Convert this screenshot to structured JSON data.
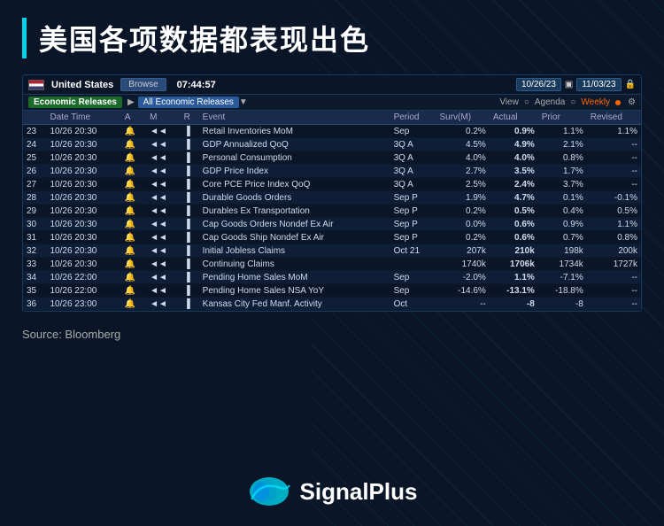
{
  "page": {
    "background": "#0a1628",
    "title": "美国各项数据都表现出色",
    "source": "Source: Bloomberg"
  },
  "terminal": {
    "country": "United States",
    "browse_label": "Browse",
    "time": "07:44:57",
    "date_from": "10/26/23",
    "date_to": "11/03/23",
    "tab_economic": "Economic Releases",
    "tab_all": "All Economic Releases",
    "view_label": "View",
    "agenda_label": "Agenda",
    "weekly_label": "Weekly",
    "columns": {
      "date_time": "Date Time",
      "a": "A",
      "m": "M",
      "r": "R",
      "event": "Event",
      "period": "Period",
      "surv": "Surv(M)",
      "actual": "Actual",
      "prior": "Prior",
      "revised": "Revised"
    },
    "rows": [
      {
        "num": "23",
        "date": "10/26",
        "time": "20:30",
        "a": "🔔",
        "m": "↓",
        "r": "▐",
        "event": "Retail Inventories MoM",
        "period": "Sep",
        "surv": "0.2%",
        "actual": "0.9%",
        "prior": "1.1%",
        "revised": "1.1%",
        "actual_neg": false
      },
      {
        "num": "24",
        "date": "10/26",
        "time": "20:30",
        "a": "🔔",
        "m": "↓",
        "r": "▐",
        "event": "GDP Annualized QoQ",
        "period": "3Q A",
        "surv": "4.5%",
        "actual": "4.9%",
        "prior": "2.1%",
        "revised": "--",
        "actual_neg": false
      },
      {
        "num": "25",
        "date": "10/26",
        "time": "20:30",
        "a": "🔔",
        "m": "↓",
        "r": "▐",
        "event": "Personal Consumption",
        "period": "3Q A",
        "surv": "4.0%",
        "actual": "4.0%",
        "prior": "0.8%",
        "revised": "--",
        "actual_neg": false
      },
      {
        "num": "26",
        "date": "10/26",
        "time": "20:30",
        "a": "🔔",
        "m": "↓",
        "r": "▐",
        "event": "GDP Price Index",
        "period": "3Q A",
        "surv": "2.7%",
        "actual": "3.5%",
        "prior": "1.7%",
        "revised": "--",
        "actual_neg": false
      },
      {
        "num": "27",
        "date": "10/26",
        "time": "20:30",
        "a": "🔔",
        "m": "↓",
        "r": "▐",
        "event": "Core PCE Price Index QoQ",
        "period": "3Q A",
        "surv": "2.5%",
        "actual": "2.4%",
        "prior": "3.7%",
        "revised": "--",
        "actual_neg": false
      },
      {
        "num": "28",
        "date": "10/26",
        "time": "20:30",
        "a": "🔔",
        "m": "↓",
        "r": "▐",
        "event": "Durable Goods Orders",
        "period": "Sep P",
        "surv": "1.9%",
        "actual": "4.7%",
        "prior": "0.1%",
        "revised": "-0.1%",
        "actual_neg": false
      },
      {
        "num": "29",
        "date": "10/26",
        "time": "20:30",
        "a": "🔔",
        "m": "↓",
        "r": "▐",
        "event": "Durables Ex Transportation",
        "period": "Sep P",
        "surv": "0.2%",
        "actual": "0.5%",
        "prior": "0.4%",
        "revised": "0.5%",
        "actual_neg": false
      },
      {
        "num": "30",
        "date": "10/26",
        "time": "20:30",
        "a": "🔔",
        "m": "↓",
        "r": "▐",
        "event": "Cap Goods Orders Nondef Ex Air",
        "period": "Sep P",
        "surv": "0.0%",
        "actual": "0.6%",
        "prior": "0.9%",
        "revised": "1.1%",
        "actual_neg": false
      },
      {
        "num": "31",
        "date": "10/26",
        "time": "20:30",
        "a": "🔔",
        "m": "↓",
        "r": "▐",
        "event": "Cap Goods Ship Nondef Ex Air",
        "period": "Sep P",
        "surv": "0.2%",
        "actual": "0.6%",
        "prior": "0.7%",
        "revised": "0.8%",
        "actual_neg": false
      },
      {
        "num": "32",
        "date": "10/26",
        "time": "20:30",
        "a": "🔔",
        "m": "↓",
        "r": "▐",
        "event": "Initial Jobless Claims",
        "period": "Oct 21",
        "surv": "207k",
        "actual": "210k",
        "prior": "198k",
        "revised": "200k",
        "actual_neg": false
      },
      {
        "num": "33",
        "date": "10/26",
        "time": "20:30",
        "a": "🔔",
        "m": "↓",
        "r": "▐",
        "event": "Continuing Claims",
        "period": "",
        "surv": "1740k",
        "actual": "1706k",
        "prior": "1734k",
        "revised": "1727k",
        "actual_neg": false
      },
      {
        "num": "34",
        "date": "10/26",
        "time": "22:00",
        "a": "🔔",
        "m": "↓",
        "r": "▐",
        "event": "Pending Home Sales MoM",
        "period": "Sep",
        "surv": "-2.0%",
        "actual": "1.1%",
        "prior": "-7.1%",
        "revised": "--",
        "actual_neg": false
      },
      {
        "num": "35",
        "date": "10/26",
        "time": "22:00",
        "a": "🔔",
        "m": "↓",
        "r": "▐",
        "event": "Pending Home Sales NSA YoY",
        "period": "Sep",
        "surv": "-14.6%",
        "actual": "-13.1%",
        "prior": "-18.8%",
        "revised": "--",
        "actual_neg": true
      },
      {
        "num": "36",
        "date": "10/26",
        "time": "23:00",
        "a": "🔔",
        "m": "↓",
        "r": "▐",
        "event": "Kansas City Fed Manf. Activity",
        "period": "Oct",
        "surv": "--",
        "actual": "-8",
        "prior": "-8",
        "revised": "--",
        "actual_neg": true
      }
    ]
  },
  "logo": {
    "name": "SignalPlus"
  }
}
